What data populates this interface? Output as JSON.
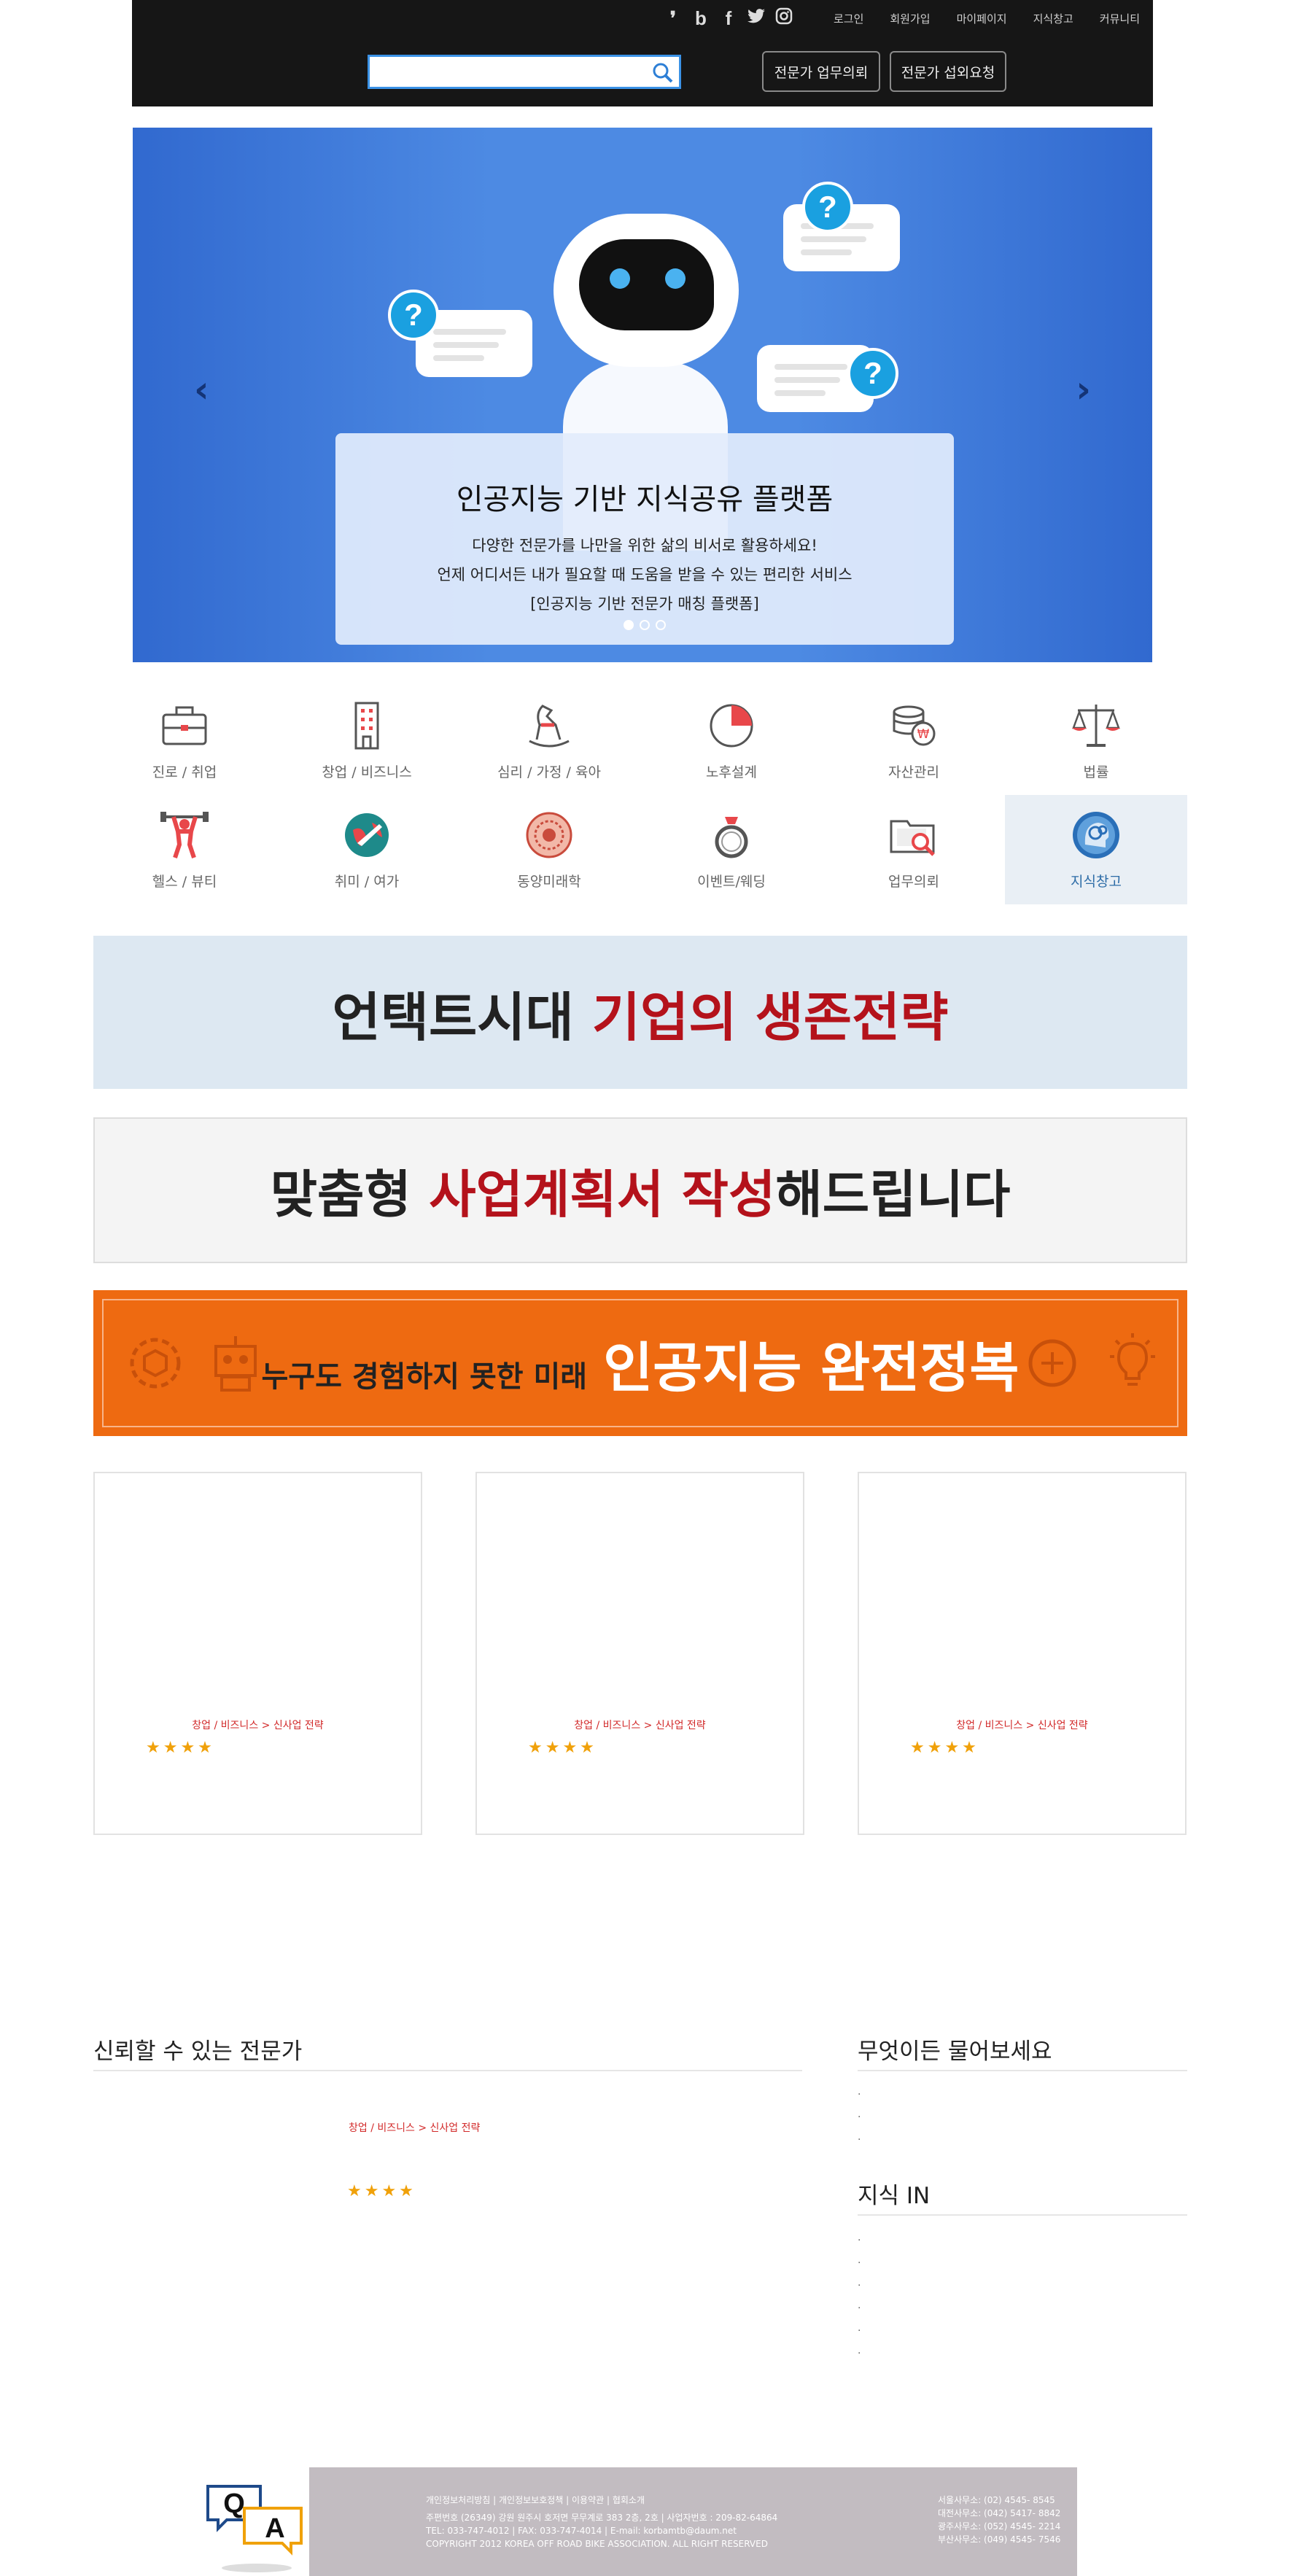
{
  "header": {
    "social_icons": [
      "blog-icon",
      "band-icon",
      "facebook-icon",
      "twitter-icon",
      "instagram-icon"
    ],
    "social_glyphs": [
      "❜",
      "b",
      "f",
      "🐦",
      "◎"
    ],
    "links": [
      "로그인",
      "회원가입",
      "마이페이지",
      "지식창고",
      "커뮤니티"
    ],
    "search": {
      "value": "",
      "placeholder": ""
    },
    "buttons": [
      "전문가 업무의뢰",
      "전문가 섭외요청"
    ]
  },
  "hero": {
    "title": "인공지능 기반 지식공유 플랫폼",
    "lines": [
      "다양한 전문가를 나만을 위한 삶의 비서로 활용하세요!",
      "언제 어디서든 내가 필요할 때 도움을 받을 수 있는 편리한 서비스",
      "[인공지능 기반 전문가 매칭 플랫폼]"
    ],
    "prev": "‹",
    "next": "›",
    "active_slide": 1,
    "slide_count": 3
  },
  "categories": [
    {
      "label": "진로 / 취업",
      "icon": "briefcase-icon"
    },
    {
      "label": "창업 / 비즈니스",
      "icon": "building-icon"
    },
    {
      "label": "심리 / 가정 / 육아",
      "icon": "rocking-horse-icon"
    },
    {
      "label": "노후설계",
      "icon": "pie-chart-icon"
    },
    {
      "label": "자산관리",
      "icon": "coins-icon"
    },
    {
      "label": "법률",
      "icon": "scales-icon"
    },
    {
      "label": "헬스 / 뷰티",
      "icon": "weightlifter-icon"
    },
    {
      "label": "취미 / 여가",
      "icon": "travel-globe-icon"
    },
    {
      "label": "동양미래학",
      "icon": "zodiac-icon"
    },
    {
      "label": "이벤트/웨딩",
      "icon": "ring-icon"
    },
    {
      "label": "업무의뢰",
      "icon": "folder-search-icon"
    },
    {
      "label": "지식창고",
      "icon": "knowledge-head-icon"
    }
  ],
  "banners": {
    "b1": {
      "part1": "언택트시대 ",
      "part2": "기업의 생존전략"
    },
    "b2": {
      "part1": "맞춤형 ",
      "part2": "사업계획서 작성",
      "part3": "해드립니다"
    },
    "b3": {
      "part1": "누구도 경험하지 못한 미래",
      "part2": "인공지능 완전정복"
    }
  },
  "cards": [
    {
      "crumb": "창업 / 비즈니스 > 신사업 전략",
      "stars": "★★★★",
      "rating": 4
    },
    {
      "crumb": "창업 / 비즈니스 > 신사업 전략",
      "stars": "★★★★",
      "rating": 4
    },
    {
      "crumb": "창업 / 비즈니스 > 신사업 전략",
      "stars": "★★★★",
      "rating": 4
    }
  ],
  "sections": {
    "trusted": {
      "title": "신뢰할 수 있는 전문가",
      "crumb": "창업 / 비즈니스 > 신사업 전략",
      "stars": "★★★★",
      "rating": 4
    },
    "ask": {
      "title": "무엇이든 물어보세요",
      "bullets": [
        ".",
        ".",
        "."
      ]
    },
    "knowledge": {
      "title": "지식 IN",
      "bullets": [
        ".",
        ".",
        ".",
        ".",
        ".",
        "."
      ]
    }
  },
  "footer": {
    "left": [
      "개인정보처리방침 | 개인정보보호정책 | 이용약관 | 협회소개",
      "주편번호 (26349) 강원 원주시 호저면 무무계로 383 2층, 2호 | 사업자번호 : 209-82-64864",
      "TEL: 033-747-4012 | FAX: 033-747-4014 | E-mail: korbamtb@daum.net",
      "COPYRIGHT 2012 KOREA OFF ROAD BIKE ASSOCIATION. ALL RIGHT RESERVED"
    ],
    "right": [
      "서울사무소: (02) 4545- 8545",
      "대전사무소: (042) 5417- 8842",
      "광주사무소: (052) 4545- 2214",
      "부산사무소: (049) 4545- 7546"
    ],
    "logo_letters": [
      "Q",
      "A"
    ]
  }
}
